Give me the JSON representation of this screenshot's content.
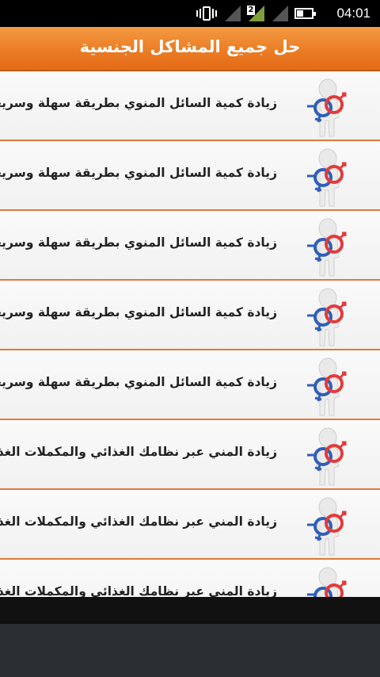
{
  "status_bar": {
    "time": "04:01",
    "sim_label": "2",
    "icons": [
      "vibrate-icon",
      "signal-icon-1",
      "signal-icon-2",
      "battery-icon"
    ]
  },
  "app_bar": {
    "title": "حل جميع المشاكل الجنسية",
    "color": "#ea7a22"
  },
  "list": {
    "items": [
      {
        "label": "زيادة كمية السائل المنوي بطريقة سهلة وسريعة",
        "icon": "gender-symbols-icon"
      },
      {
        "label": "زيادة كمية السائل المنوي بطريقة سهلة وسريعة",
        "icon": "gender-symbols-icon"
      },
      {
        "label": "زيادة كمية السائل المنوي بطريقة سهلة وسريعة",
        "icon": "gender-symbols-icon"
      },
      {
        "label": "زيادة كمية السائل المنوي بطريقة سهلة وسريعة",
        "icon": "gender-symbols-icon"
      },
      {
        "label": "زيادة كمية السائل المنوي بطريقة سهلة وسريعة",
        "icon": "gender-symbols-icon"
      },
      {
        "label": "زيادة المني عبر نظامك الغذائي والمكملات الغذائية",
        "icon": "gender-symbols-icon"
      },
      {
        "label": "زيادة المني عبر نظامك الغذائي والمكملات الغذائية",
        "icon": "gender-symbols-icon"
      },
      {
        "label": "زيادة المني عبر نظامك الغذائي والمكملات الغذائية",
        "icon": "gender-symbols-icon"
      }
    ]
  }
}
